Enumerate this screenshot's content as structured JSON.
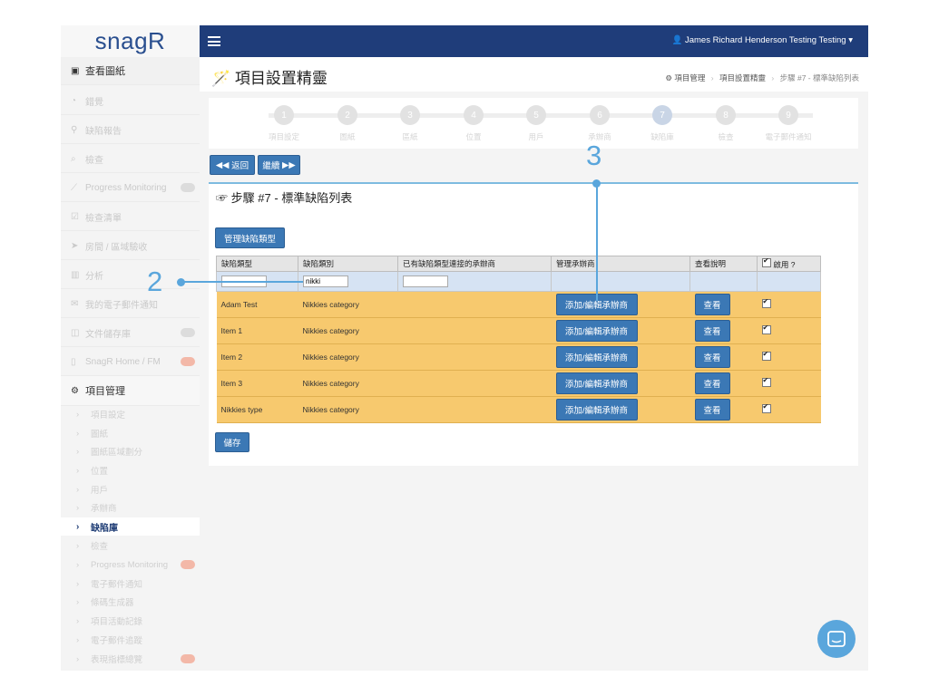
{
  "app": {
    "logo_text": "snagR",
    "user_name": "James Richard Henderson Testing Testing"
  },
  "page": {
    "title": "項目設置精靈",
    "title_icon": "magic-wand-icon"
  },
  "breadcrumb": {
    "items": [
      "項目管理",
      "項目設置精靈",
      "步驟 #7 - 標準缺陷列表"
    ]
  },
  "sidebar": {
    "top": {
      "label": "查看圖紙",
      "icon": "image-icon"
    },
    "items": [
      {
        "label": "錯覺",
        "icon": "dashboard-icon"
      },
      {
        "label": "缺陷報告",
        "icon": "map-pin-icon"
      },
      {
        "label": "檢查",
        "icon": "search-icon"
      },
      {
        "label": "Progress Monitoring",
        "icon": "chart-icon"
      },
      {
        "label": "檢查清單",
        "icon": "checklist-icon"
      },
      {
        "label": "房間 / 區域驗收",
        "icon": "send-icon"
      },
      {
        "label": "分析",
        "icon": "bar-chart-icon"
      },
      {
        "label": "我的電子郵件通知",
        "icon": "envelope-icon"
      },
      {
        "label": "文件儲存庫",
        "icon": "document-icon"
      },
      {
        "label": "SnagR Home / FM",
        "icon": "file-icon"
      }
    ],
    "section": {
      "label": "項目管理",
      "icon": "cogs-icon"
    },
    "sub_items": [
      {
        "label": "項目設定"
      },
      {
        "label": "圖紙"
      },
      {
        "label": "圖紙區域劃分"
      },
      {
        "label": "位置"
      },
      {
        "label": "用戶"
      },
      {
        "label": "承辦商"
      },
      {
        "label": "缺陷庫"
      },
      {
        "label": "檢查"
      },
      {
        "label": "Progress Monitoring"
      },
      {
        "label": "電子郵件通知"
      },
      {
        "label": "條碼生成器"
      },
      {
        "label": "項目活動記錄"
      },
      {
        "label": "電子郵件追蹤"
      },
      {
        "label": "表現指標總覽"
      }
    ]
  },
  "wizard": {
    "steps": [
      {
        "num": "1",
        "label": "項目設定"
      },
      {
        "num": "2",
        "label": "圖紙"
      },
      {
        "num": "3",
        "label": "區紙"
      },
      {
        "num": "4",
        "label": "位置"
      },
      {
        "num": "5",
        "label": "用戶"
      },
      {
        "num": "6",
        "label": "承辦商"
      },
      {
        "num": "7",
        "label": "缺陷庫"
      },
      {
        "num": "8",
        "label": "檢查"
      },
      {
        "num": "9",
        "label": "電子郵件通知"
      }
    ],
    "back_label": "返回",
    "next_label": "繼續"
  },
  "panel": {
    "title": "步驟 #7 - 標準缺陷列表",
    "manage_label": "管理缺陷類型",
    "save_label": "儲存"
  },
  "table": {
    "headers": [
      "缺陷類型",
      "缺陷類別",
      "已有缺陷類型連接的承辦商",
      "管理承辦商",
      "查看說明",
      "啟用 ?"
    ],
    "filter": {
      "type": "",
      "category": "nikki",
      "contractor": ""
    },
    "rows": [
      {
        "type": "Adam Test",
        "category": "Nikkies category"
      },
      {
        "type": "Item 1",
        "category": "Nikkies category"
      },
      {
        "type": "Item 2",
        "category": "Nikkies category"
      },
      {
        "type": "Item 3",
        "category": "Nikkies category"
      },
      {
        "type": "Nikkies type",
        "category": "Nikkies category"
      }
    ],
    "add_label": "添加/編輯承辦商",
    "view_label": "查看"
  },
  "annotations": {
    "a2": "2",
    "a3": "3"
  },
  "colors": {
    "topbar": "#1f3d7a",
    "button": "#3b78b5",
    "row": "#f7c96e",
    "accent": "#5aa6dc"
  }
}
